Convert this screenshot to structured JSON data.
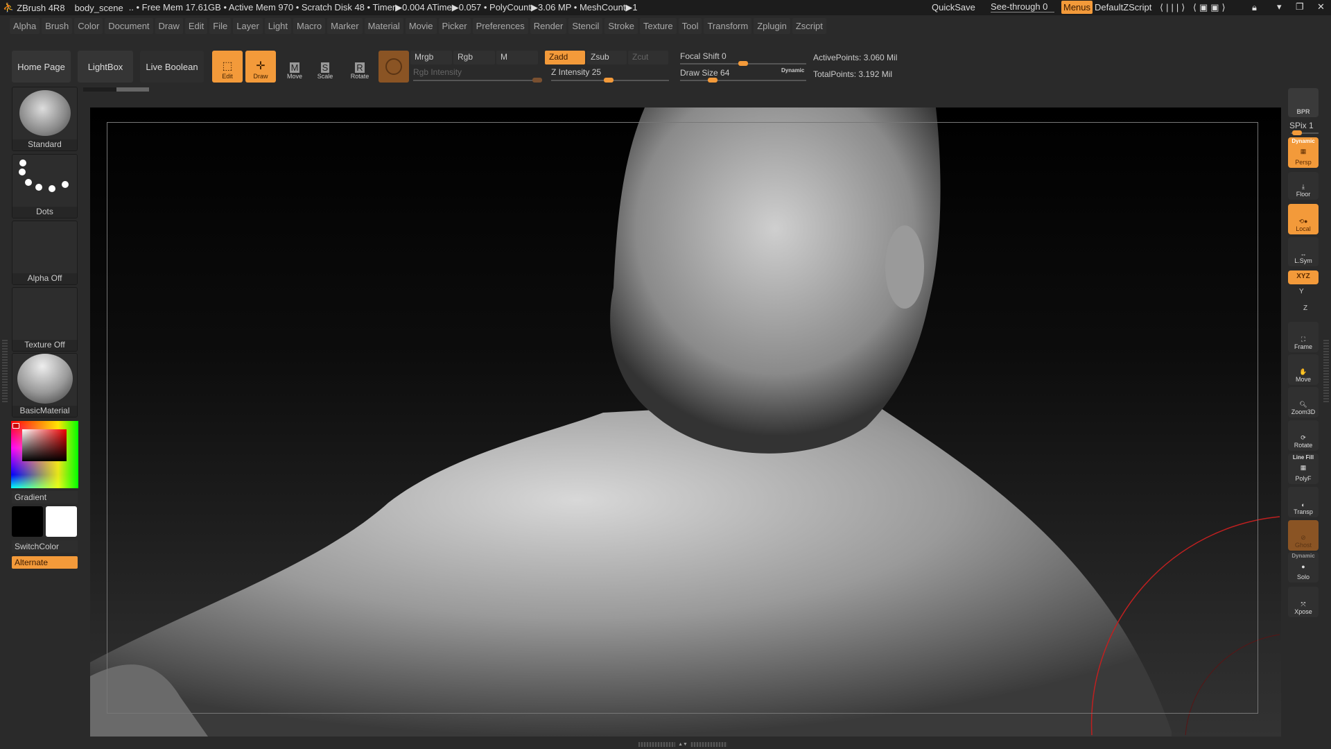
{
  "titlebar": {
    "app": "ZBrush 4R8",
    "document": "body_scene",
    "stats": ".. • Free Mem 17.61GB • Active Mem 970 • Scratch Disk 48 •  Timer▶0.004 ATime▶0.057 • PolyCount▶3.06 MP  • MeshCount▶1",
    "quicksave": "QuickSave",
    "seethrough": "See-through  0",
    "menus": "Menus",
    "script": "DefaultZScript"
  },
  "menu": [
    "Alpha",
    "Brush",
    "Color",
    "Document",
    "Draw",
    "Edit",
    "File",
    "Layer",
    "Light",
    "Macro",
    "Marker",
    "Material",
    "Movie",
    "Picker",
    "Preferences",
    "Render",
    "Stencil",
    "Stroke",
    "Texture",
    "Tool",
    "Transform",
    "Zplugin",
    "Zscript"
  ],
  "toolbar": {
    "home": "Home Page",
    "lightbox": "LightBox",
    "liveboolean": "Live Boolean",
    "edit": "Edit",
    "draw": "Draw",
    "move": "Move",
    "scale": "Scale",
    "rotate": "Rotate",
    "mrgb": "Mrgb",
    "rgb": "Rgb",
    "m": "M",
    "zadd": "Zadd",
    "zsub": "Zsub",
    "zcut": "Zcut",
    "rgb_intensity": "Rgb Intensity",
    "z_intensity": "Z Intensity 25",
    "focal_shift": "Focal Shift 0",
    "draw_size": "Draw Size 64",
    "dynamic": "Dynamic",
    "active_points": "ActivePoints: 3.060 Mil",
    "total_points": "TotalPoints: 3.192 Mil",
    "z_intensity_value": 25,
    "draw_size_value": 64,
    "focal_shift_value": 0
  },
  "left": {
    "brush": "Standard",
    "stroke": "Dots",
    "alpha": "Alpha Off",
    "texture": "Texture Off",
    "material": "BasicMaterial",
    "gradient": "Gradient",
    "switchcolor": "SwitchColor",
    "alternate": "Alternate"
  },
  "right": {
    "bpr": "BPR",
    "spix": "SPix 1",
    "dynamic": "Dynamic",
    "persp": "Persp",
    "floor": "Floor",
    "local": "Local",
    "lsym": "L.Sym",
    "xyz": "XYZ",
    "y": "Y",
    "z": "Z",
    "frame": "Frame",
    "move": "Move",
    "zoom3d": "Zoom3D",
    "rotate": "Rotate",
    "linefill": "Line Fill",
    "polyf": "PolyF",
    "transp": "Transp",
    "ghost": "Ghost",
    "dynamic2": "Dynamic",
    "solo": "Solo",
    "xpose": "Xpose"
  },
  "colors": {
    "accent": "#f39a3a",
    "bg": "#2a2a2a"
  }
}
